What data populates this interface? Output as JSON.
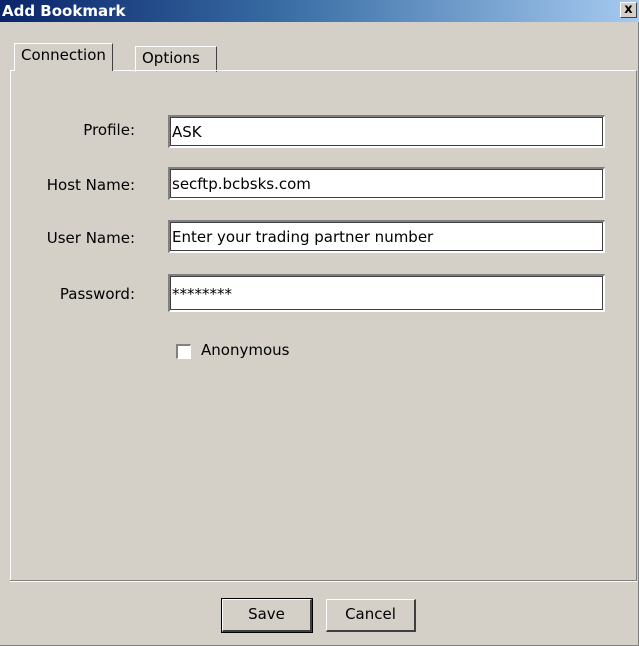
{
  "window": {
    "title": "Add Bookmark",
    "close_glyph": "x"
  },
  "tabs": [
    {
      "label": "Connection",
      "selected": true
    },
    {
      "label": "Options",
      "selected": false
    }
  ],
  "form": {
    "profile": {
      "label": "Profile:",
      "value": "ASK"
    },
    "host": {
      "label": "Host Name:",
      "value": "secftp.bcbsks.com"
    },
    "user": {
      "label": "User Name:",
      "value": "Enter your trading partner number"
    },
    "password": {
      "label": "Password:",
      "value": "********"
    },
    "anonymous": {
      "label": "Anonymous",
      "checked": false
    }
  },
  "buttons": {
    "save": "Save",
    "cancel": "Cancel"
  },
  "colors": {
    "dialog_bg": "#d4d0c8",
    "titlebar_start": "#0a246a",
    "titlebar_end": "#a6caf0"
  }
}
